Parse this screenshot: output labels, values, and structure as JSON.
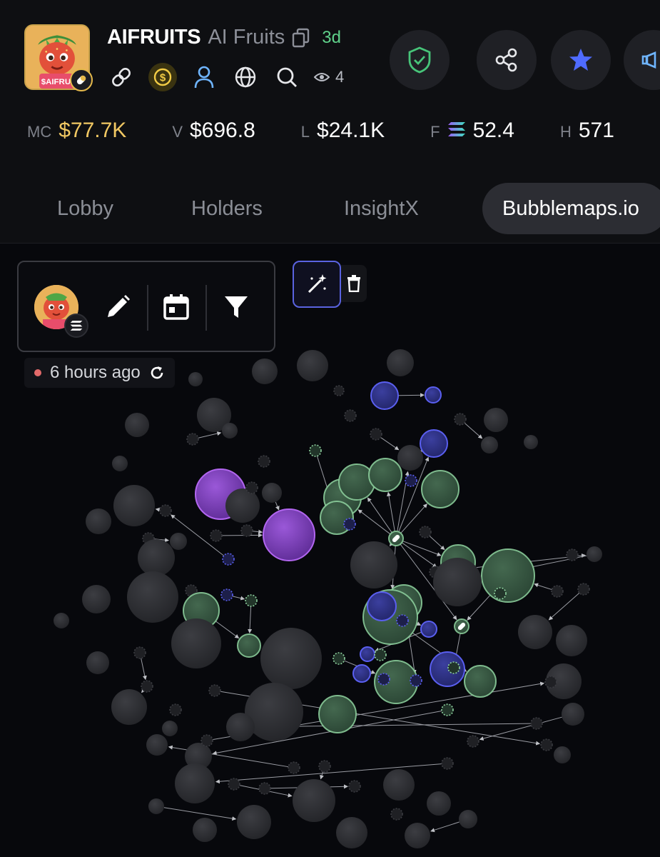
{
  "token": {
    "ticker": "AIFRUITS",
    "name": "AI Fruits",
    "age": "3d",
    "views": "4"
  },
  "header_icons": [
    "link-icon",
    "coin-icon",
    "user-icon",
    "globe-icon",
    "search-icon",
    "eye-icon"
  ],
  "actions": [
    "shield-check-icon",
    "share-icon",
    "star-icon",
    "megaphone-icon"
  ],
  "stats": [
    {
      "label": "MC",
      "value": "$77.7K",
      "color": "#f1c863"
    },
    {
      "label": "V",
      "value": "$696.8"
    },
    {
      "label": "L",
      "value": "$24.1K"
    },
    {
      "label": "F",
      "value": "52.4"
    },
    {
      "label": "H",
      "value": "571"
    }
  ],
  "tabs": [
    {
      "label": "Lobby",
      "active": false
    },
    {
      "label": "Holders",
      "active": false
    },
    {
      "label": "InsightX",
      "active": false
    },
    {
      "label": "Bubblemaps.io",
      "active": true
    }
  ],
  "map": {
    "updated": "6 hours ago",
    "toolbar": [
      "pencil-icon",
      "calendar-icon",
      "filter-icon"
    ],
    "colors": {
      "gray": "#3a3b40",
      "green": "#8fd3a0",
      "blue": "#5a5ff0",
      "purple": "#b266f0"
    }
  },
  "accent_colors": {
    "gold": "#f1c863",
    "age_green": "#5fd18a",
    "star_blue": "#4f6bff"
  }
}
